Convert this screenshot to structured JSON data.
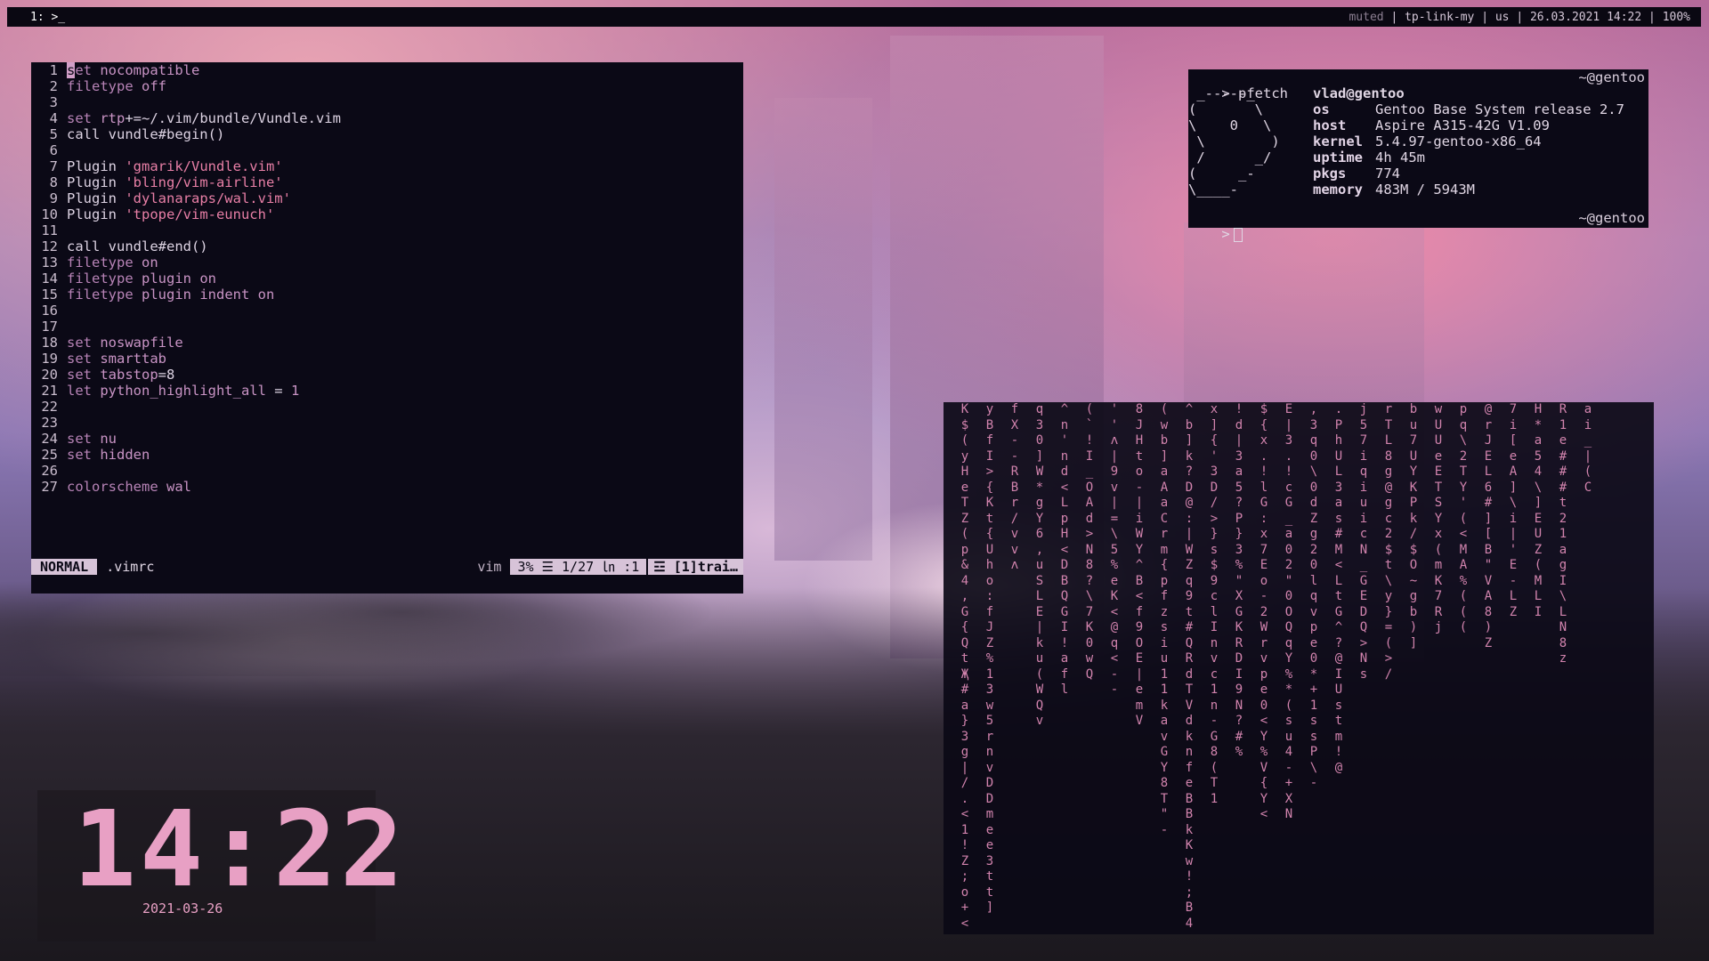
{
  "topbar": {
    "workspace": "1: >_",
    "muted": "muted",
    "status": " | tp-link-my | us | 26.03.2021 14:22 | 100%"
  },
  "vim": {
    "lines": [
      {
        "n": "1",
        "parts": [
          [
            "cur",
            "s"
          ],
          [
            "kw",
            "et "
          ],
          [
            "val",
            "nocompatible"
          ]
        ]
      },
      {
        "n": "2",
        "parts": [
          [
            "kw",
            "filetype "
          ],
          [
            "val",
            "off"
          ]
        ]
      },
      {
        "n": "3",
        "parts": []
      },
      {
        "n": "4",
        "parts": [
          [
            "kw",
            "set "
          ],
          [
            "val",
            "rtp"
          ],
          [
            "plain",
            "+=~/.vim/bundle/Vundle.vim"
          ]
        ]
      },
      {
        "n": "5",
        "parts": [
          [
            "plain",
            "call vundle#begin()"
          ]
        ]
      },
      {
        "n": "6",
        "parts": []
      },
      {
        "n": "7",
        "parts": [
          [
            "plain",
            "Plugin "
          ],
          [
            "str",
            "'gmarik/Vundle.vim'"
          ]
        ]
      },
      {
        "n": "8",
        "parts": [
          [
            "plain",
            "Plugin "
          ],
          [
            "str",
            "'bling/vim-airline'"
          ]
        ]
      },
      {
        "n": "9",
        "parts": [
          [
            "plain",
            "Plugin "
          ],
          [
            "str",
            "'dylanaraps/wal.vim'"
          ]
        ]
      },
      {
        "n": "10",
        "parts": [
          [
            "plain",
            "Plugin "
          ],
          [
            "str",
            "'tpope/vim-eunuch'"
          ]
        ]
      },
      {
        "n": "11",
        "parts": []
      },
      {
        "n": "12",
        "parts": [
          [
            "plain",
            "call vundle#end()"
          ]
        ]
      },
      {
        "n": "13",
        "parts": [
          [
            "kw",
            "filetype "
          ],
          [
            "val",
            "on"
          ]
        ]
      },
      {
        "n": "14",
        "parts": [
          [
            "kw",
            "filetype "
          ],
          [
            "val",
            "plugin on"
          ]
        ]
      },
      {
        "n": "15",
        "parts": [
          [
            "kw",
            "filetype "
          ],
          [
            "val",
            "plugin indent on"
          ]
        ]
      },
      {
        "n": "16",
        "parts": []
      },
      {
        "n": "17",
        "parts": []
      },
      {
        "n": "18",
        "parts": [
          [
            "kw",
            "set "
          ],
          [
            "val",
            "noswapfile"
          ]
        ]
      },
      {
        "n": "19",
        "parts": [
          [
            "kw",
            "set "
          ],
          [
            "val",
            "smarttab"
          ]
        ]
      },
      {
        "n": "20",
        "parts": [
          [
            "kw",
            "set "
          ],
          [
            "val",
            "tabstop"
          ],
          [
            "plain",
            "=8"
          ]
        ]
      },
      {
        "n": "21",
        "parts": [
          [
            "kw",
            "let "
          ],
          [
            "val",
            "python_highlight_all"
          ],
          [
            "plain",
            " = "
          ],
          [
            "val",
            "1"
          ]
        ]
      },
      {
        "n": "22",
        "parts": []
      },
      {
        "n": "23",
        "parts": []
      },
      {
        "n": "24",
        "parts": [
          [
            "kw",
            "set "
          ],
          [
            "val",
            "nu"
          ]
        ]
      },
      {
        "n": "25",
        "parts": [
          [
            "kw",
            "set "
          ],
          [
            "val",
            "hidden"
          ]
        ]
      },
      {
        "n": "26",
        "parts": []
      },
      {
        "n": "27",
        "parts": [
          [
            "kw",
            "colorscheme "
          ],
          [
            "val",
            "wal"
          ]
        ]
      }
    ],
    "mode": "NORMAL",
    "filename": ".vimrc",
    "filetype": "vim",
    "position": "3% ☰ 1/27 ㏑ :1",
    "trailing": "☲ [1]trai…"
  },
  "pfetch": {
    "command": "> pfetch",
    "host_right": "~@gentoo",
    "art": " _-----_\n(       \\\n\\    0   \\\n \\        )\n /      _/\n(     _-\n\\____-",
    "user": "vlad@gentoo",
    "info": [
      {
        "key": "os",
        "value": "Gentoo Base System release 2.7"
      },
      {
        "key": "host",
        "value": "Aspire A315-42G V1.09"
      },
      {
        "key": "kernel",
        "value": "5.4.97-gentoo-x86_64"
      },
      {
        "key": "uptime",
        "value": "4h 45m"
      },
      {
        "key": "pkgs",
        "value": "774"
      },
      {
        "key": "memory",
        "value": "483M / 5943M"
      }
    ],
    "prompt": ">",
    "prompt_right": "~@gentoo"
  },
  "matrix": {
    "columns": [
      "K$(yHeTZ(p&4,G{QtҖ#a}3g|/.<1!Z;o+<",
      " yBfI>{Kt{Uho:f J Z%1 3w5 rnvDDmee3tt ]",
      "fX-- R B r /      v v ʌ    ",
      "q3 0]W*gY6          ,u S L E | k u ( W Q v",
      "           ^ n ' n d < L p H < D B Q G I ! a f l",
      "      (`! I_O A d > N 8 ? \\ 7 K 0 w Q",
      "         ' ' ʌ | 9 v | = \\ 5 % e K < @ q < - -",
      "8 J H t o - | i W Y ^ B < f 9 O E | e m V",
      "(wb]aAaCrm{pfzsiu 1 1 k a v  G Y 8 T \" -",
      "^b]k?D@:|WZq9t#QRdTVdknfeBBkKw!;B4",
      "x]{'3D/>}s$9c  lInvc 1 n   - G 8 ( T 1",
      "!d|3a5?P}3%\"X G K R D I 9 N ? # %",
      "$ { x . ! l G : x 7 E o - 2 W r v p e 0 < Y % V { Y <",
      "E|3.!cG̲a02\"0O Q q Y % * ( s u 4 - + X N",
      "        ,3q 0 \\ 0  d Z g 2 0 l q v p e 0 * + 1 s s P \\ -",
      ".P hUL3as#M  < Lt G       ^ ? @ I U  s  t  m! @",
      "j5 7 i q i u i c N _ G E D Q > N s",
      "rTL 8 g @ g c 2 $ t \\ y } = ( > /",
      "b u 7 U Y K P k / $ O ~ g b ) ]",
      "w U U e E T S Y x ( m  K 7 R j",
      "p q   \\ 2 T Y ' ( < M A % ( ( (",
      "@rJEL6 # ] [ B \" V A 8 ) Z",
      "7i[e A ] \\ i | ' E - L Z",
      "H*a5 4 \\ ] E U Z ( M L I",
      "R 1e ### t 2 1 a g I \\ L N 8 z",
      "     a i _ | ( C"
    ]
  },
  "clock": {
    "time": "14:22",
    "date": "2021-03-26"
  }
}
